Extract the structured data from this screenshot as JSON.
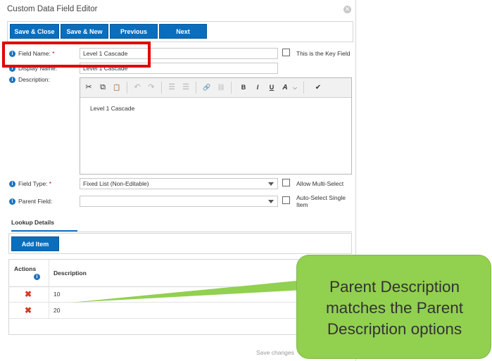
{
  "window": {
    "title": "Custom Data Field Editor",
    "close_icon": "close-icon"
  },
  "toolbar": {
    "save_close_label": "Save & Close",
    "save_new_label": "Save & New",
    "previous_label": "Previous",
    "next_label": "Next",
    "button_color": "#0a6ebd"
  },
  "form": {
    "field_name_label": "Field Name:",
    "required_mark": "*",
    "field_name_value": "Level 1 Cascade",
    "key_field_label": "This is the Key Field",
    "display_name_label": "Display Name:",
    "display_name_value": "Level 1 Cascade",
    "description_label": "Description:",
    "description_value": "Level 1 Cascade",
    "field_type_label": "Field Type:",
    "field_type_value": "Fixed List (Non-Editable)",
    "allow_multi_select_label": "Allow Multi-Select",
    "parent_field_label": "Parent Field:",
    "parent_field_value": "",
    "auto_select_label": "Auto-Select Single Item"
  },
  "editor_toolbar": {
    "cut": "✂",
    "copy": "⧉",
    "paste": "📋",
    "undo": "↶",
    "redo": "↷",
    "ordered_list": "☰",
    "unordered_list": "☰",
    "link": "🔗",
    "unlink": "⛓",
    "bold": "B",
    "italic": "I",
    "underline": "U",
    "font_color": "A",
    "font_color_caret": "⌵",
    "spellcheck": "✔"
  },
  "lookup": {
    "tab_label": "Lookup Details",
    "add_item_label": "Add Item",
    "columns": {
      "actions": "Actions",
      "description": "Description"
    },
    "rows": [
      {
        "description": "10"
      },
      {
        "description": "20"
      }
    ],
    "delete_icon": "✖",
    "save_changes_label": "Save changes"
  },
  "annotation": {
    "callout_line1": "Parent Description",
    "callout_line2": "matches the Parent",
    "callout_line3": "Description options",
    "highlight_color": "#e00000",
    "callout_color": "#92d050"
  }
}
